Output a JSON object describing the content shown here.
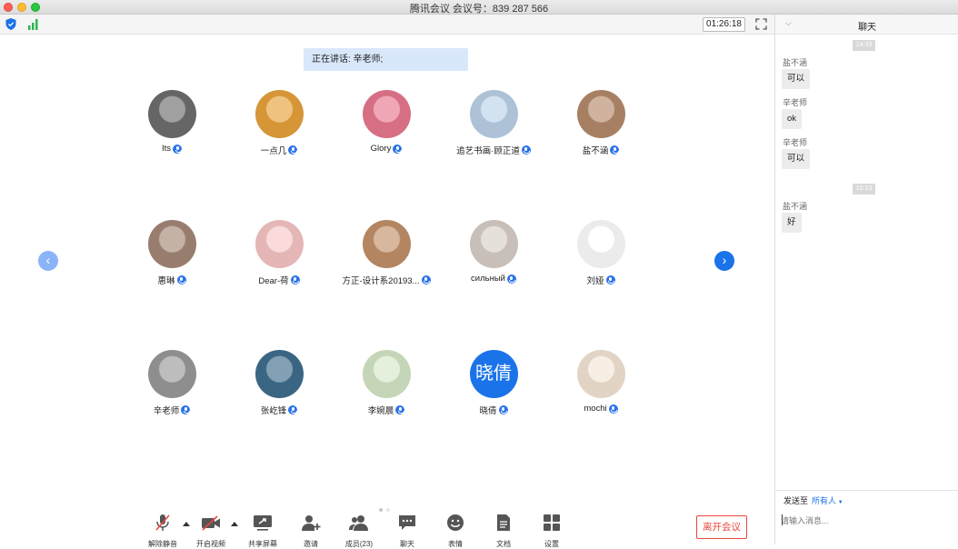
{
  "window": {
    "title": "腾讯会议 会议号：839 287 566"
  },
  "topbar": {
    "timer": "01:26:18"
  },
  "speaker": {
    "text": "正在讲话: 辛老师;"
  },
  "participants": [
    {
      "name": "Its",
      "bg": "#6e6e6e",
      "initial": ""
    },
    {
      "name": "一点几",
      "bg": "#e8a23c",
      "initial": ""
    },
    {
      "name": "Glory",
      "bg": "#e8788e",
      "initial": ""
    },
    {
      "name": "追艺书画·顾正道",
      "bg": "#bcd2e8",
      "initial": ""
    },
    {
      "name": "盐不涵",
      "bg": "#b58a6a",
      "initial": ""
    },
    {
      "name": "惠琳",
      "bg": "#a58878",
      "initial": ""
    },
    {
      "name": "Dear-荷",
      "bg": "#f7c6c6",
      "initial": ""
    },
    {
      "name": "方正-设计系20193...",
      "bg": "#c29068",
      "initial": ""
    },
    {
      "name": "сильный",
      "bg": "#d8cfc8",
      "initial": ""
    },
    {
      "name": "刘娅",
      "bg": "#ffffff",
      "initial": ""
    },
    {
      "name": "辛老师",
      "bg": "#9a9a9a",
      "initial": ""
    },
    {
      "name": "张屹锋",
      "bg": "#3f6e8e",
      "initial": ""
    },
    {
      "name": "李婉晨",
      "bg": "#d6e8c8",
      "initial": ""
    },
    {
      "name": "晓倩",
      "bg": "#1a73e8",
      "initial": "晓倩"
    },
    {
      "name": "mochi",
      "bg": "#f5e6d6",
      "initial": ""
    }
  ],
  "toolbar": {
    "unmute": "解除静音",
    "start_video": "开启视频",
    "share_screen": "共享屏幕",
    "invite": "邀请",
    "members": "成员(23)",
    "chat": "聊天",
    "reactions": "表情",
    "docs": "文档",
    "settings": "设置",
    "leave": "离开会议"
  },
  "chat": {
    "title": "聊天",
    "messages": [
      {
        "type": "time",
        "text": "14:33"
      },
      {
        "type": "msg",
        "sender": "盐不涵",
        "text": "可以"
      },
      {
        "type": "msg",
        "sender": "辛老师",
        "text": "ok"
      },
      {
        "type": "msg",
        "sender": "辛老师",
        "text": "可以"
      },
      {
        "type": "time",
        "text": "15:13"
      },
      {
        "type": "msg",
        "sender": "盐不涵",
        "text": "好"
      }
    ],
    "send_to_label": "发送至",
    "send_to_target": "所有人",
    "input_placeholder": "请输入消息..."
  },
  "colors": {
    "accent": "#1a73e8",
    "leave": "#e8473d",
    "speaker_bg": "#d9e7fb"
  }
}
